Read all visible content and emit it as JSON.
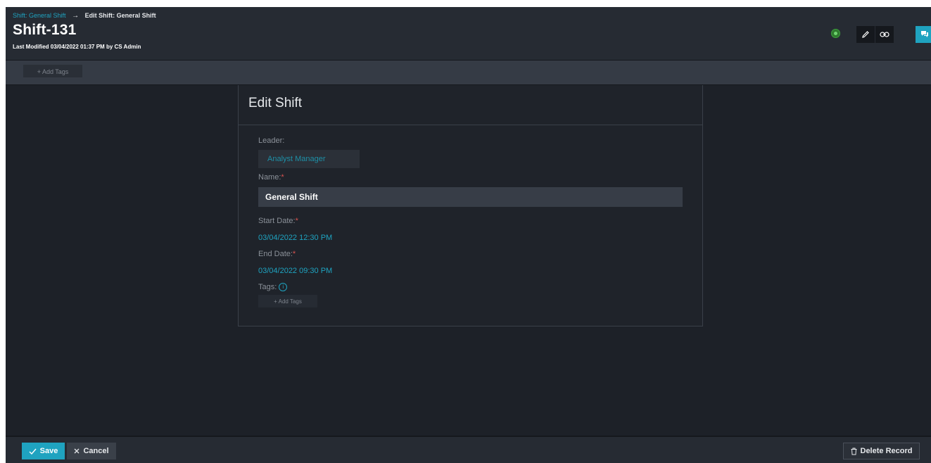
{
  "breadcrumb": {
    "parent": "Shift: General Shift",
    "arrow": "→",
    "current": "Edit Shift: General Shift"
  },
  "record": {
    "title": "Shift-131",
    "last_modified": "Last Modified 03/04/2022 01:37 PM by CS Admin"
  },
  "header_actions": {
    "status_icon": "online-status-icon",
    "edit_icon": "pencil-icon",
    "link_icon": "link-icon",
    "chat_icon": "chat-icon"
  },
  "tags_bar": {
    "add_tags_label": "+ Add Tags"
  },
  "form": {
    "title": "Edit Shift",
    "leader": {
      "label": "Leader:",
      "value": "Analyst Manager"
    },
    "name": {
      "label": "Name:",
      "required": "*",
      "value": "General Shift"
    },
    "start_date": {
      "label": "Start Date:",
      "required": "*",
      "value": "03/04/2022 12:30 PM"
    },
    "end_date": {
      "label": "End Date:",
      "required": "*",
      "value": "03/04/2022 09:30 PM"
    },
    "tags": {
      "label": "Tags:",
      "info": "i",
      "add_label": "+ Add Tags"
    }
  },
  "footer": {
    "save_label": "Save",
    "cancel_label": "Cancel",
    "delete_label": "Delete Record"
  },
  "colors": {
    "accent": "#1fa3c0",
    "background": "#1d2128",
    "required": "#d9534f",
    "status": "#6fd36f"
  }
}
